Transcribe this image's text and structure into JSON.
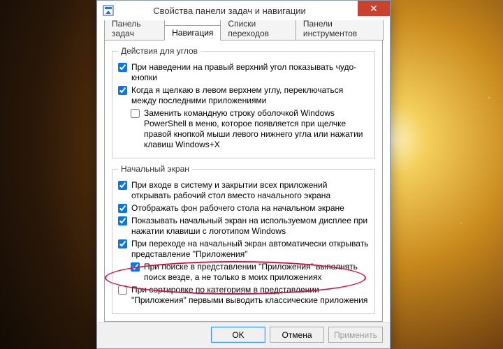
{
  "window": {
    "title": "Свойства панели задач и навигации"
  },
  "tabs": {
    "taskbar": "Панель задач",
    "navigation": "Навигация",
    "jumplists": "Списки переходов",
    "toolbars": "Панели инструментов"
  },
  "groups": {
    "corners": {
      "legend": "Действия для углов",
      "opt_charms": "При наведении на правый верхний угол показывать чудо-кнопки",
      "opt_recent": "Когда я щелкаю в левом верхнем углу, переключаться между последними приложениями",
      "opt_powershell": "Заменить командную строку оболочкой Windows PowerShell в меню, которое появляется при щелчке правой кнопкой мыши левого нижнего угла или нажатии клавиш Windows+X"
    },
    "start": {
      "legend": "Начальный экран",
      "opt_desktop_on_signin": "При входе в систему и закрытии всех приложений открывать рабочий стол вместо начального экрана",
      "opt_desktop_bg": "Отображать фон рабочего стола на начальном экране",
      "opt_same_display": "Показывать начальный экран на используемом дисплее при нажатии клавиши с логотипом Windows",
      "opt_apps_view": "При переходе на начальный экран автоматически открывать представление \"Приложения\"",
      "opt_search_everywhere": "При поиске в представлении \"Приложения\" выполнять поиск везде, а не только в моих приложениях",
      "opt_desktop_apps_first": "При сортировке по категориям в представлении \"Приложения\" первыми выводить классические приложения"
    }
  },
  "checks": {
    "charms": true,
    "recent": true,
    "powershell": false,
    "desktop_on_signin": true,
    "desktop_bg": true,
    "same_display": true,
    "apps_view": true,
    "search_everywhere": true,
    "desktop_apps_first": false
  },
  "buttons": {
    "ok": "OK",
    "cancel": "Отмена",
    "apply": "Применить"
  }
}
